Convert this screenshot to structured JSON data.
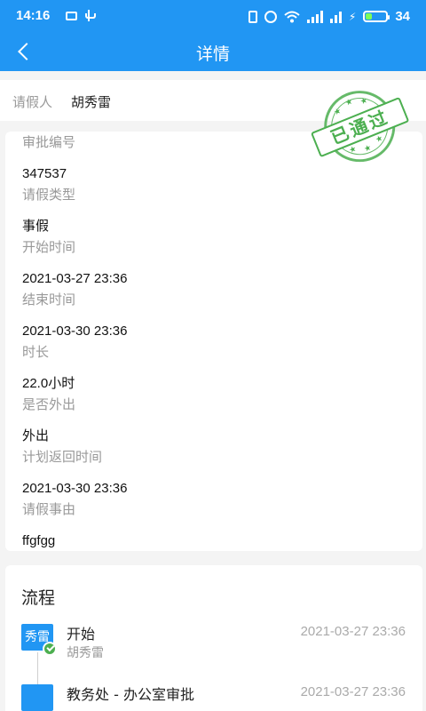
{
  "status_bar": {
    "time": "14:16",
    "battery_level": "34",
    "battery_fraction": 0.34,
    "icons": [
      "mail-icon",
      "usb-icon",
      "vibrate-icon",
      "alarm-icon",
      "wifi-icon",
      "signal-icon",
      "hd-icon",
      "charging-icon",
      "battery-icon"
    ]
  },
  "nav": {
    "title": "详情",
    "back_icon": "chevron-left-icon"
  },
  "applicant": {
    "label": "请假人",
    "value": "胡秀雷"
  },
  "stamp": {
    "text": "已通过",
    "color": "#4caf50"
  },
  "details": [
    {
      "label": "审批编号",
      "value": "347537"
    },
    {
      "label": "请假类型",
      "value": "事假"
    },
    {
      "label": "开始时间",
      "value": "2021-03-27 23:36"
    },
    {
      "label": "结束时间",
      "value": "2021-03-30 23:36"
    },
    {
      "label": "时长",
      "value": "22.0小时"
    },
    {
      "label": "是否外出",
      "value": "外出"
    },
    {
      "label": "计划返回时间",
      "value": "2021-03-30 23:36"
    },
    {
      "label": "请假事由",
      "value": "ffgfgg"
    }
  ],
  "flow": {
    "title": "流程",
    "steps": [
      {
        "avatar": "秀雷",
        "name": "开始",
        "person": "胡秀雷",
        "time": "2021-03-27 23:36",
        "done": true
      },
      {
        "avatar": "",
        "name": "教务处 - 办公室审批",
        "person": "",
        "time": "2021-03-27 23:36",
        "done": false
      }
    ]
  },
  "colors": {
    "primary": "#2196f3",
    "approved": "#4caf50",
    "background": "#f4f4f4"
  }
}
